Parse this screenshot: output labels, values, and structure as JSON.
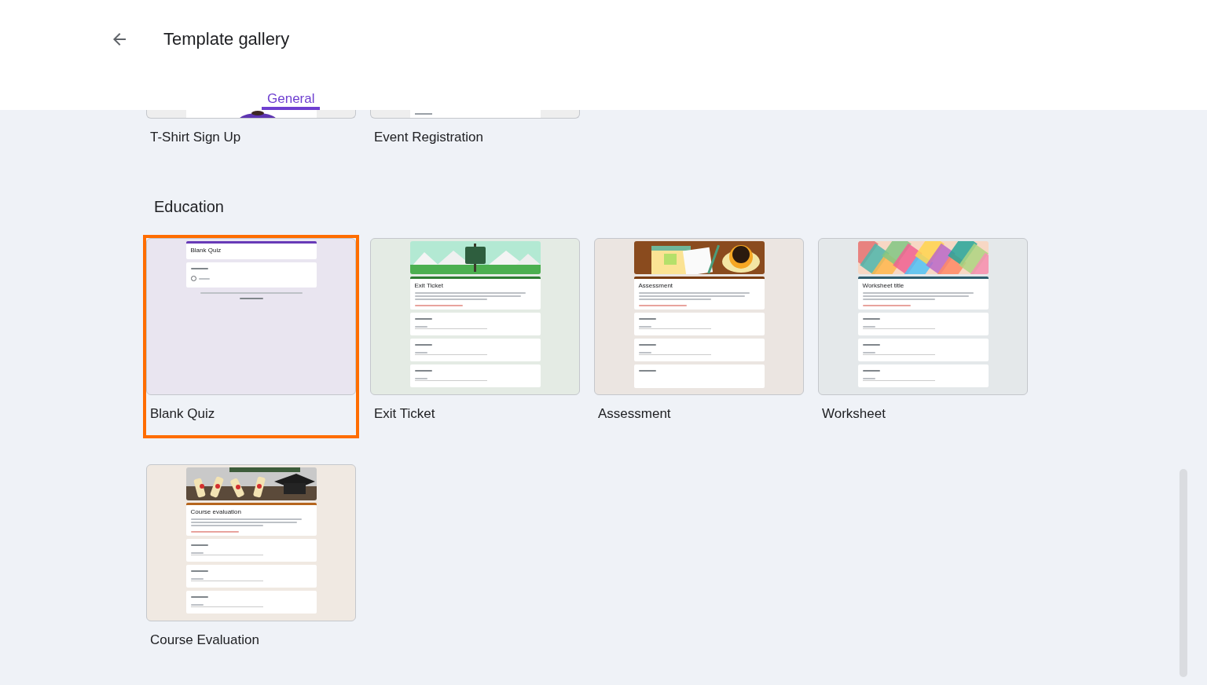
{
  "header": {
    "title": "Template gallery"
  },
  "tabs": [
    {
      "label": "General",
      "selected": true
    }
  ],
  "sections": [
    {
      "templates": [
        {
          "title": "T-Shirt Sign Up",
          "selected": false,
          "cropped": true
        },
        {
          "title": "Event Registration",
          "selected": false,
          "cropped": true,
          "preview": {
            "kind": "field"
          }
        }
      ]
    },
    {
      "heading": "Education",
      "templates": [
        {
          "title": "Blank Quiz",
          "selected": true,
          "cropped": false,
          "color": "#673ab7",
          "banner": false,
          "form": {
            "kind": "blank",
            "title": "Blank Quiz",
            "questions": [
              {
                "kind": "choice"
              }
            ]
          }
        },
        {
          "title": "Exit Ticket",
          "selected": false,
          "cropped": false,
          "color": "#2e7d32",
          "banner": true,
          "form": {
            "kind": "standard",
            "title": "Exit Ticket",
            "questions": [
              {
                "kind": "text"
              },
              {
                "kind": "text"
              },
              {
                "kind": "text"
              }
            ]
          }
        },
        {
          "title": "Assessment",
          "selected": false,
          "cropped": false,
          "color": "#7a3d12",
          "banner": true,
          "form": {
            "kind": "standard",
            "title": "Assessment",
            "questions": [
              {
                "kind": "text"
              },
              {
                "kind": "text"
              },
              {
                "kind": "section"
              }
            ]
          }
        },
        {
          "title": "Worksheet",
          "selected": false,
          "cropped": false,
          "color": "#2f5d6e",
          "banner": true,
          "form": {
            "kind": "standard",
            "title": "Worksheet title",
            "questions": [
              {
                "kind": "text"
              },
              {
                "kind": "text"
              },
              {
                "kind": "text"
              }
            ]
          }
        },
        {
          "title": "Course Evaluation",
          "selected": false,
          "cropped": false,
          "color": "#b5651d",
          "banner": true,
          "form": {
            "kind": "standard",
            "title": "Course evaluation",
            "questions": [
              {
                "kind": "text"
              },
              {
                "kind": "text"
              },
              {
                "kind": "text"
              }
            ]
          }
        }
      ]
    }
  ]
}
